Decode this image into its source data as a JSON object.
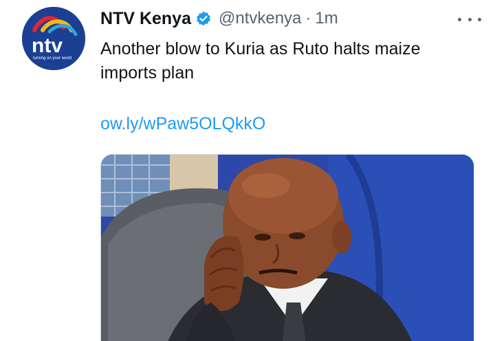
{
  "author": {
    "display_name": "NTV Kenya",
    "handle": "@ntvkenya",
    "separator": "·",
    "time": "1m",
    "avatar_logo_text": "ntv",
    "avatar_tagline": "turning on your world"
  },
  "tweet": {
    "text": "Another blow to Kuria as Ruto halts maize imports plan",
    "link": "ow.ly/wPaw5OLQkkO"
  },
  "icons": {
    "verified": "verified-badge-icon",
    "more": "more-options-icon"
  },
  "colors": {
    "link": "#1d9bf0",
    "verified": "#1d9bf0",
    "secondary_text": "#536471",
    "primary_text": "#0f1419"
  }
}
